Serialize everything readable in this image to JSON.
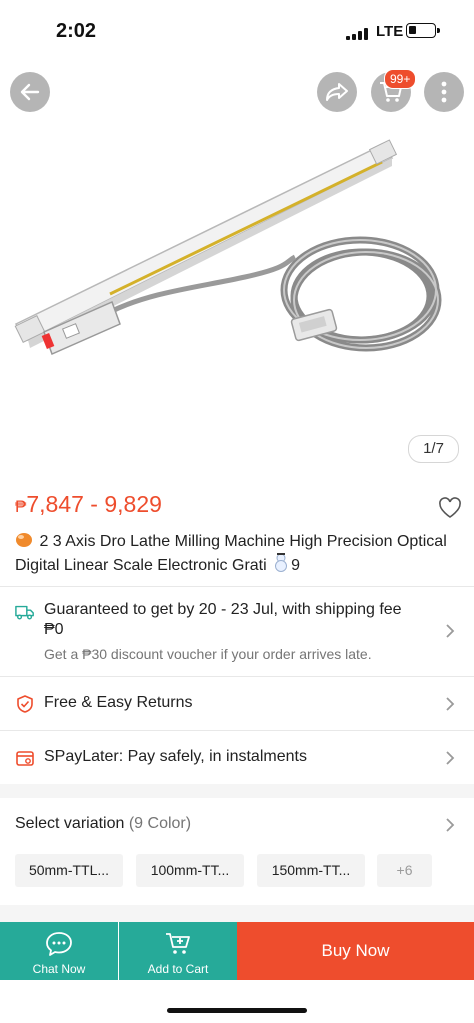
{
  "status_bar": {
    "time": "2:02",
    "network": "LTE"
  },
  "header": {
    "cart_badge": "99+",
    "image_counter": "1/7"
  },
  "product": {
    "currency": "₱",
    "price_range": "7,847 - 9,829",
    "title": "2 3 Axis Dro Lathe Milling Machine High Precision Optical Digital Linear Scale Electronic Grati",
    "title_suffix": "9"
  },
  "shipping": {
    "line1": "Guaranteed to get by 20 - 23 Jul, with shipping fee",
    "line2": "₱0",
    "note": "Get a ₱30 discount voucher if your order arrives late."
  },
  "returns": {
    "label": "Free & Easy Returns"
  },
  "paylater": {
    "label": "SPayLater: Pay safely, in instalments"
  },
  "variation": {
    "title": "Select variation",
    "count": "(9 Color)",
    "options": [
      "50mm-TTL...",
      "100mm-TT...",
      "150mm-TT..."
    ],
    "more": "+6"
  },
  "bottom_bar": {
    "chat_label": "Chat Now",
    "cart_label": "Add to Cart",
    "buy_label": "Buy Now"
  },
  "colors": {
    "brand": "#ee4d2d",
    "teal": "#26aa99"
  }
}
